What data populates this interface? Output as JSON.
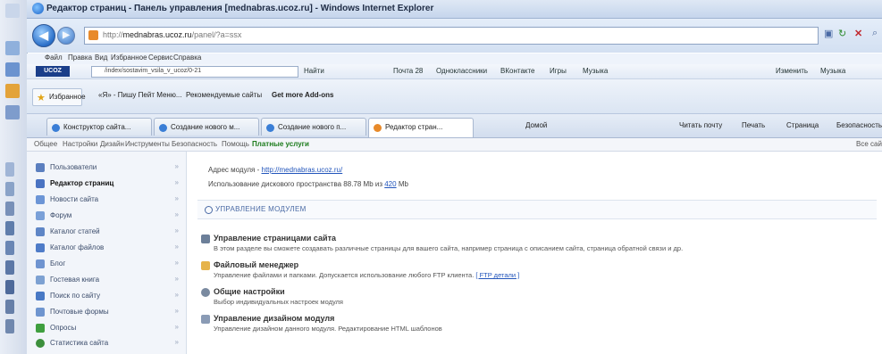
{
  "window": {
    "title": "Редактор страниц - Панель управления [mednabras.ucoz.ru] - Windows Internet Explorer"
  },
  "address": {
    "prefix": "http://",
    "domain": "mednabras.ucoz.ru",
    "suffix": "/panel/?a=ssx"
  },
  "menu": [
    "Файл",
    "Правка",
    "Вид",
    "Избранное",
    "Сервис",
    "Справка"
  ],
  "linkbar": {
    "logo": "UCOZ",
    "search": "/index/sostavim_vsila_v_ucoz/0-21",
    "items": [
      "Найти",
      "Почта 28",
      "Одноклассники",
      "ВКонтакте",
      "Игры",
      "Музыка",
      "Изменить",
      "Музыка"
    ]
  },
  "favorites": {
    "button": "Избранное",
    "items": [
      "«Я» - Пишу Пейт Меню...",
      "Рекомендуемые сайты",
      "Get more Add-ons"
    ]
  },
  "tabs": [
    {
      "label": "Конструктор сайта..."
    },
    {
      "label": "Создание нового м..."
    },
    {
      "label": "Создание нового п..."
    },
    {
      "label": "Редактор стран..."
    }
  ],
  "tab_tools": [
    "Домой",
    "Читать почту",
    "Печать",
    "Страница",
    "Безопасность"
  ],
  "panel_menu": [
    "Общее",
    "Настройки",
    "Дизайн",
    "Инструменты",
    "Безопасность",
    "Помощь",
    "Платные услуги",
    "Все сайты"
  ],
  "sidebar": {
    "items": [
      {
        "label": "Пользователи",
        "color": "#5b7fbf"
      },
      {
        "label": "Редактор страниц",
        "color": "#4a73c2",
        "active": true
      },
      {
        "label": "Новости сайта",
        "color": "#6c95d6"
      },
      {
        "label": "Форум",
        "color": "#7aa0d8"
      },
      {
        "label": "Каталог статей",
        "color": "#5f86c6"
      },
      {
        "label": "Каталог файлов",
        "color": "#4f7cc8"
      },
      {
        "label": "Блог",
        "color": "#6f94d0"
      },
      {
        "label": "Гостевая книга",
        "color": "#7da1d2"
      },
      {
        "label": "Поиск по сайту",
        "color": "#4979c5"
      },
      {
        "label": "Почтовые формы",
        "color": "#6f95cf"
      },
      {
        "label": "Опросы",
        "color": "#3f9f3f"
      },
      {
        "label": "Статистика сайта",
        "color": "#3c8f3c"
      }
    ]
  },
  "main": {
    "address_label": "Адрес модуля - ",
    "address_link": "http://mednabras.ucoz.ru/",
    "usage_text": "Использование дискового пространства 88.78 Mb из ",
    "usage_limit": "420",
    "usage_unit": " Mb",
    "modules_header": "УПРАВЛЕНИЕ МОДУЛЕМ",
    "modules": [
      {
        "title": "Управление страницами сайта",
        "desc": "В этом разделе вы сможете создавать различные страницы для вашего сайта, например страница с описанием сайта, страница обратной связи и др.",
        "color": "#6c7f99"
      },
      {
        "title": "Файловый менеджер",
        "desc": "Управление файлами и папками. Допускается использование любого FTP клиента. ",
        "link": "[ FTP детали ]",
        "color": "#e6b34a"
      },
      {
        "title": "Общие настройки",
        "desc": "Выбор индивидуальных настроек модуля",
        "color": "#7a8aa0"
      },
      {
        "title": "Управление дизайном модуля",
        "desc": "Управление дизайном данного модуля. Редактирование HTML шаблонов",
        "color": "#8a9bb5"
      }
    ]
  }
}
